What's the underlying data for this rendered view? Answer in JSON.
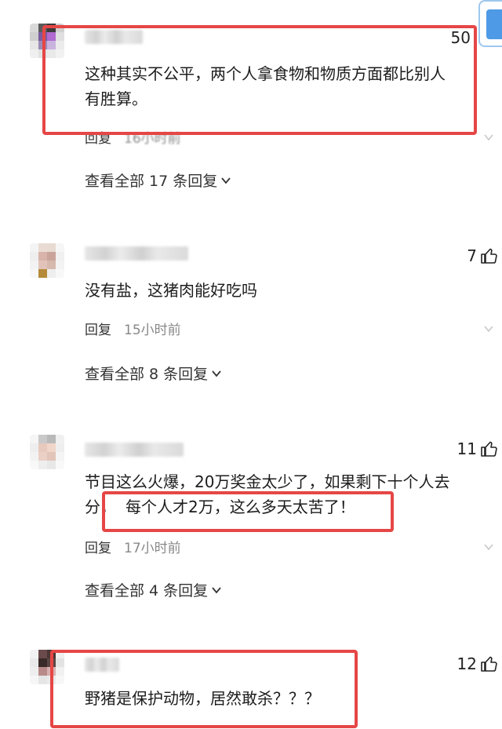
{
  "comments": [
    {
      "likes": "50",
      "text": "这种其实不公平，两个人拿食物和物质方面都比别人有胜算。",
      "text_line1": "这种其实不公平，两个人拿食物和物质方面都比别人",
      "text_line2": "有胜算。",
      "reply_label": "回复",
      "time": "16小时前",
      "view_all": "查看全部 17 条回复"
    },
    {
      "likes": "7",
      "text": "没有盐，这猪肉能好吃吗",
      "reply_label": "回复",
      "time": "15小时前",
      "view_all": "查看全部 8 条回复"
    },
    {
      "likes": "11",
      "text_line1": "节目这么火爆，20万奖金太少了，如果剩下十个人去",
      "text_line2_a": "分，",
      "text_line2_b": "每个人才2万，这么多天太苦了！",
      "reply_label": "回复",
      "time": "17小时前",
      "view_all": "查看全部 4 条回复"
    },
    {
      "likes": "12",
      "text": "野猪是保护动物，居然敢杀？？？"
    }
  ],
  "colors": {
    "highlight_box": "#e64646",
    "muted_text": "#888888",
    "scroll_button": "#4f9ae6"
  },
  "icons": {
    "like": "thumb-up-icon",
    "expand": "chevron-down-icon",
    "more": "chevron-down-icon"
  }
}
